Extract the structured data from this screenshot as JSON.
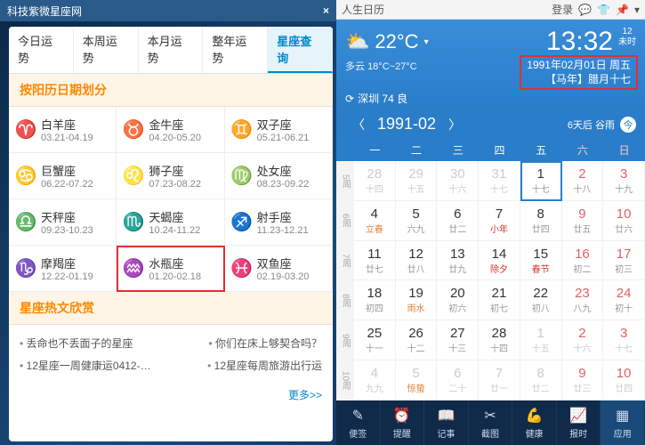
{
  "left": {
    "title": "科技紫微星座网",
    "tabs": [
      "今日运势",
      "本周运势",
      "本月运势",
      "整年运势",
      "星座查询"
    ],
    "active_tab": 4,
    "section1": "按阳历日期划分",
    "zodiac": [
      {
        "icon": "♈",
        "name": "白羊座",
        "range": "03.21-04.19"
      },
      {
        "icon": "♉",
        "name": "金牛座",
        "range": "04.20-05.20"
      },
      {
        "icon": "♊",
        "name": "双子座",
        "range": "05.21-06.21"
      },
      {
        "icon": "♋",
        "name": "巨蟹座",
        "range": "06.22-07.22"
      },
      {
        "icon": "♌",
        "name": "狮子座",
        "range": "07.23-08.22"
      },
      {
        "icon": "♍",
        "name": "处女座",
        "range": "08.23-09.22"
      },
      {
        "icon": "♎",
        "name": "天秤座",
        "range": "09.23-10.23"
      },
      {
        "icon": "♏",
        "name": "天蝎座",
        "range": "10.24-11.22"
      },
      {
        "icon": "♐",
        "name": "射手座",
        "range": "11.23-12.21"
      },
      {
        "icon": "♑",
        "name": "摩羯座",
        "range": "12.22-01.19"
      },
      {
        "icon": "♒",
        "name": "水瓶座",
        "range": "01.20-02.18"
      },
      {
        "icon": "♓",
        "name": "双鱼座",
        "range": "02.19-03.20"
      }
    ],
    "highlight_index": 10,
    "section2": "星座热文欣赏",
    "hot": [
      [
        "丢命也不丢面子的星座",
        "你们在床上够契合吗？"
      ],
      [
        "12星座一周健康运0412-…",
        "12星座每周旅游出行运"
      ]
    ],
    "more": "更多>>"
  },
  "right": {
    "app_title": "人生日历",
    "login": "登录",
    "weather": {
      "icon": "⛅",
      "temp": "22°C",
      "desc": "多云",
      "range": "18°C~27°C"
    },
    "time": "13:32",
    "time_day": "12",
    "time_shi": "未时",
    "date_line1": "1991年02月01日 周五",
    "date_line2": "【马年】腊月十七",
    "location": "深圳 74 良",
    "month_label": "1991-02",
    "next_term": "6天后 谷雨",
    "today_btn": "今",
    "dow": [
      "一",
      "二",
      "三",
      "四",
      "五",
      "六",
      "日"
    ],
    "weeks": [
      "5周",
      "6周",
      "7周",
      "8周",
      "9周",
      "10周"
    ],
    "days": [
      [
        {
          "n": "28",
          "s": "十四",
          "o": 1
        },
        {
          "n": "29",
          "s": "十五",
          "o": 1
        },
        {
          "n": "30",
          "s": "十六",
          "o": 1
        },
        {
          "n": "31",
          "s": "十七",
          "o": 1
        },
        {
          "n": "1",
          "s": "十七",
          "sel": 1
        },
        {
          "n": "2",
          "s": "十八",
          "w": 1
        },
        {
          "n": "3",
          "s": "十九",
          "w": 1
        }
      ],
      [
        {
          "n": "4",
          "s": "立春",
          "t": 1
        },
        {
          "n": "5",
          "s": "六九"
        },
        {
          "n": "6",
          "s": "廿二"
        },
        {
          "n": "7",
          "s": "小年",
          "f": 1
        },
        {
          "n": "8",
          "s": "廿四"
        },
        {
          "n": "9",
          "s": "廿五",
          "w": 1
        },
        {
          "n": "10",
          "s": "廿六",
          "w": 1
        }
      ],
      [
        {
          "n": "11",
          "s": "廿七"
        },
        {
          "n": "12",
          "s": "廿八"
        },
        {
          "n": "13",
          "s": "廿九"
        },
        {
          "n": "14",
          "s": "除夕",
          "f": 1
        },
        {
          "n": "15",
          "s": "春节",
          "f": 1
        },
        {
          "n": "16",
          "s": "初二",
          "w": 1
        },
        {
          "n": "17",
          "s": "初三",
          "w": 1
        }
      ],
      [
        {
          "n": "18",
          "s": "初四"
        },
        {
          "n": "19",
          "s": "雨水",
          "t": 1
        },
        {
          "n": "20",
          "s": "初六"
        },
        {
          "n": "21",
          "s": "初七"
        },
        {
          "n": "22",
          "s": "初八"
        },
        {
          "n": "23",
          "s": "八九",
          "w": 1
        },
        {
          "n": "24",
          "s": "初十",
          "w": 1
        }
      ],
      [
        {
          "n": "25",
          "s": "十一"
        },
        {
          "n": "26",
          "s": "十二"
        },
        {
          "n": "27",
          "s": "十三"
        },
        {
          "n": "28",
          "s": "十四"
        },
        {
          "n": "1",
          "s": "十五",
          "o": 1
        },
        {
          "n": "2",
          "s": "十六",
          "o": 1,
          "w": 1
        },
        {
          "n": "3",
          "s": "十七",
          "o": 1,
          "w": 1
        }
      ],
      [
        {
          "n": "4",
          "s": "九九",
          "o": 1
        },
        {
          "n": "5",
          "s": "惊蛰",
          "o": 1,
          "t": 1
        },
        {
          "n": "6",
          "s": "二十",
          "o": 1
        },
        {
          "n": "7",
          "s": "廿一",
          "o": 1
        },
        {
          "n": "8",
          "s": "廿二",
          "o": 1
        },
        {
          "n": "9",
          "s": "廿三",
          "o": 1,
          "w": 1
        },
        {
          "n": "10",
          "s": "廿四",
          "o": 1,
          "w": 1
        }
      ]
    ],
    "bottom": [
      {
        "icon": "✎",
        "label": "便签"
      },
      {
        "icon": "⏰",
        "label": "提醒"
      },
      {
        "icon": "📖",
        "label": "记事"
      },
      {
        "icon": "✂",
        "label": "截图"
      },
      {
        "icon": "💪",
        "label": "健康"
      },
      {
        "icon": "📈",
        "label": "报时"
      },
      {
        "icon": "▦",
        "label": "应用"
      }
    ]
  }
}
